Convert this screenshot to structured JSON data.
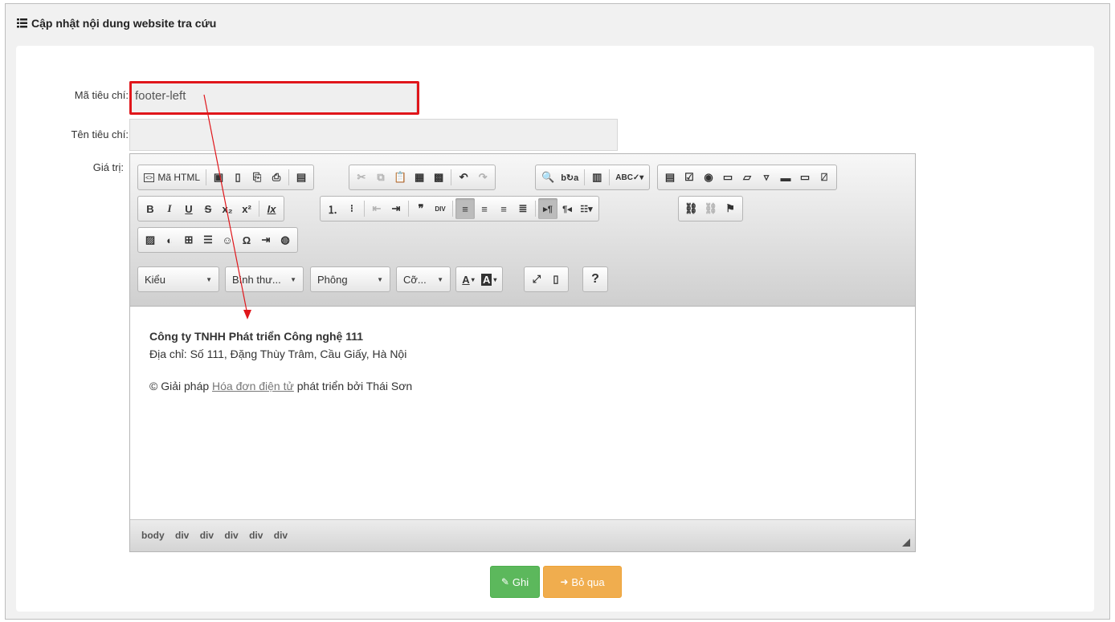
{
  "header": {
    "title": "Cập nhật nội dung website tra cứu",
    "icon": "list-icon"
  },
  "form": {
    "code_label": "Mã tiêu chí:",
    "code_value": "footer-left",
    "name_label": "Tên tiêu chí:",
    "name_value": "",
    "value_label": "Giá trị:"
  },
  "toolbar": {
    "source_label": "Mã HTML",
    "bold": "B",
    "italic": "I",
    "underline": "U",
    "strike": "S",
    "subscript": "x₂",
    "superscript": "x²",
    "remove_format": "Ix",
    "quote": "❞",
    "div": "DIV",
    "format_styles": "Kiểu",
    "format_paragraph": "Bình thư...",
    "font": "Phông",
    "size": "Cỡ...",
    "text_color": "A",
    "bg_color": "A",
    "help": "?"
  },
  "editor": {
    "line1": "Công ty TNHH Phát triển Công nghệ 111",
    "line2": "Địa chỉ: Số 111, Đặng Thùy Trâm, Cầu Giấy, Hà Nội",
    "line3_prefix": "© Giải pháp ",
    "line3_link": "Hóa đơn điện tử",
    "line3_suffix": " phát triển bởi Thái Sơn",
    "path": [
      "body",
      "div",
      "div",
      "div",
      "div",
      "div"
    ]
  },
  "buttons": {
    "save": "Ghi",
    "cancel": "Bỏ qua"
  },
  "colors": {
    "save": "#5cb85c",
    "cancel": "#f0ad4e",
    "highlight": "#e0161b"
  }
}
